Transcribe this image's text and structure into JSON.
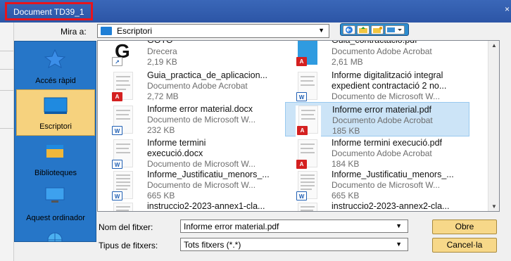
{
  "window": {
    "title": "Document TD39_1",
    "close_glyph": "×"
  },
  "lookin": {
    "label": "Mira a:",
    "value": "Escriptori",
    "icon": "folder-icon"
  },
  "places": [
    {
      "label": "Accés ràpid",
      "icon": "star-icon",
      "selected": false
    },
    {
      "label": "Escriptori",
      "icon": "desktop-icon",
      "selected": true
    },
    {
      "label": "Biblioteques",
      "icon": "libraries-icon",
      "selected": false
    },
    {
      "label": "Aquest ordinador",
      "icon": "computer-icon",
      "selected": false
    },
    {
      "label": "",
      "icon": "network-icon",
      "selected": false
    }
  ],
  "files": [
    {
      "name": "GOTO",
      "type": "Drecera",
      "size": "2,19 KB",
      "kind": "shortcut"
    },
    {
      "name": "Guia_contractacio.pdf",
      "type": "Documento Adobe Acrobat",
      "size": "2,61 MB",
      "kind": "pdf"
    },
    {
      "name": "Guia_practica_de_aplicacion...",
      "type": "Documento Adobe Acrobat",
      "size": "2,72 MB",
      "kind": "pdf"
    },
    {
      "name": "Informe digitalització integral",
      "name2": "expedient contractació 2 no...",
      "type": "Documento de Microsoft W...",
      "size": "",
      "kind": "word"
    },
    {
      "name": "Informe error material.docx",
      "type": "Documento de Microsoft W...",
      "size": "232 KB",
      "kind": "word"
    },
    {
      "name": "Informe error material.pdf",
      "type": "Documento Adobe Acrobat",
      "size": "185 KB",
      "kind": "pdf",
      "selected": true
    },
    {
      "name": "Informe termini",
      "name2": "execució.docx",
      "type": "Documento de Microsoft W...",
      "size": "",
      "kind": "word"
    },
    {
      "name": "Informe termini execució.pdf",
      "type": "Documento Adobe Acrobat",
      "size": "184 KB",
      "kind": "pdf"
    },
    {
      "name": "Informe_Justificatiu_menors_...",
      "type": "Documento de Microsoft W...",
      "size": "665 KB",
      "kind": "word"
    },
    {
      "name": "Informe_Justificatiu_menors_...",
      "type": "Documento de Microsoft W...",
      "size": "665 KB",
      "kind": "word"
    },
    {
      "name": "instruccio2-2023-annex1-cla...",
      "type": "",
      "size": "",
      "kind": "word"
    },
    {
      "name": "instruccio2-2023-annex2-cla...",
      "type": "",
      "size": "",
      "kind": "word"
    }
  ],
  "filename": {
    "label": "Nom del fitxer:",
    "value": "Informe error material.pdf"
  },
  "filetype": {
    "label": "Tipus de fitxers:",
    "value": "Tots fitxers (*.*)"
  },
  "buttons": {
    "open": "Obre",
    "cancel": "Cancel·la"
  },
  "colors": {
    "titlebar": "#2c55a6",
    "places_bg": "#2676c8",
    "selected_place": "#f6d27e",
    "selected_file": "#cce4f7",
    "button": "#f7d889"
  }
}
